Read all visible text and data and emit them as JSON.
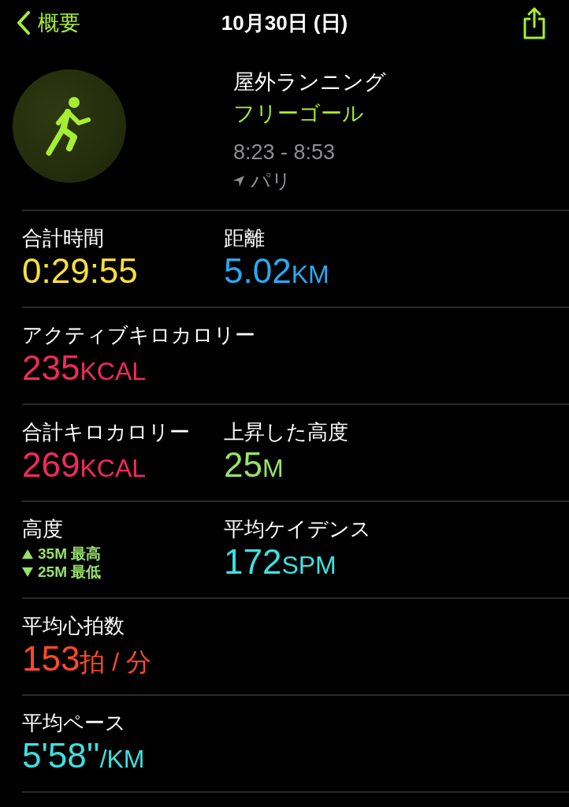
{
  "nav": {
    "back_label": "概要",
    "title": "10月30日 (日)"
  },
  "workout": {
    "type": "屋外ランニング",
    "goal": "フリーゴール",
    "time": "8:23 - 8:53",
    "location": "パリ"
  },
  "rows": [
    {
      "cells": [
        {
          "kind": "metric",
          "label": "合計時間",
          "value": "0:29:55",
          "color": "#f7e03c"
        },
        {
          "kind": "metric",
          "label": "距離",
          "value": "5.02",
          "unit": "KM",
          "color": "#2aa9f2"
        }
      ]
    },
    {
      "cells": [
        {
          "kind": "metric",
          "label": "アクティブキロカロリー",
          "value": "235",
          "unit": "KCAL",
          "color": "#f22a5c"
        }
      ]
    },
    {
      "cells": [
        {
          "kind": "metric",
          "label": "合計キロカロリー",
          "value": "269",
          "unit": "KCAL",
          "color": "#f22a5c"
        },
        {
          "kind": "metric",
          "label": "上昇した高度",
          "value": "25",
          "unit": "M",
          "color": "#98e26a"
        }
      ]
    },
    {
      "cells": [
        {
          "kind": "range",
          "label": "高度",
          "high": "35M 最高",
          "low": "25M 最低",
          "color": "#98e26a"
        },
        {
          "kind": "metric",
          "label": "平均ケイデンス",
          "value": "172",
          "unit": "SPM",
          "color": "#3fe0e0"
        }
      ]
    },
    {
      "cells": [
        {
          "kind": "metric",
          "label": "平均心拍数",
          "value": "153",
          "unit": "拍 / 分",
          "color": "#ff4a2c"
        }
      ]
    },
    {
      "cells": [
        {
          "kind": "metric",
          "label": "平均ペース",
          "value": "5'58''",
          "unit": "/KM",
          "color": "#3fe0e0"
        }
      ]
    }
  ]
}
